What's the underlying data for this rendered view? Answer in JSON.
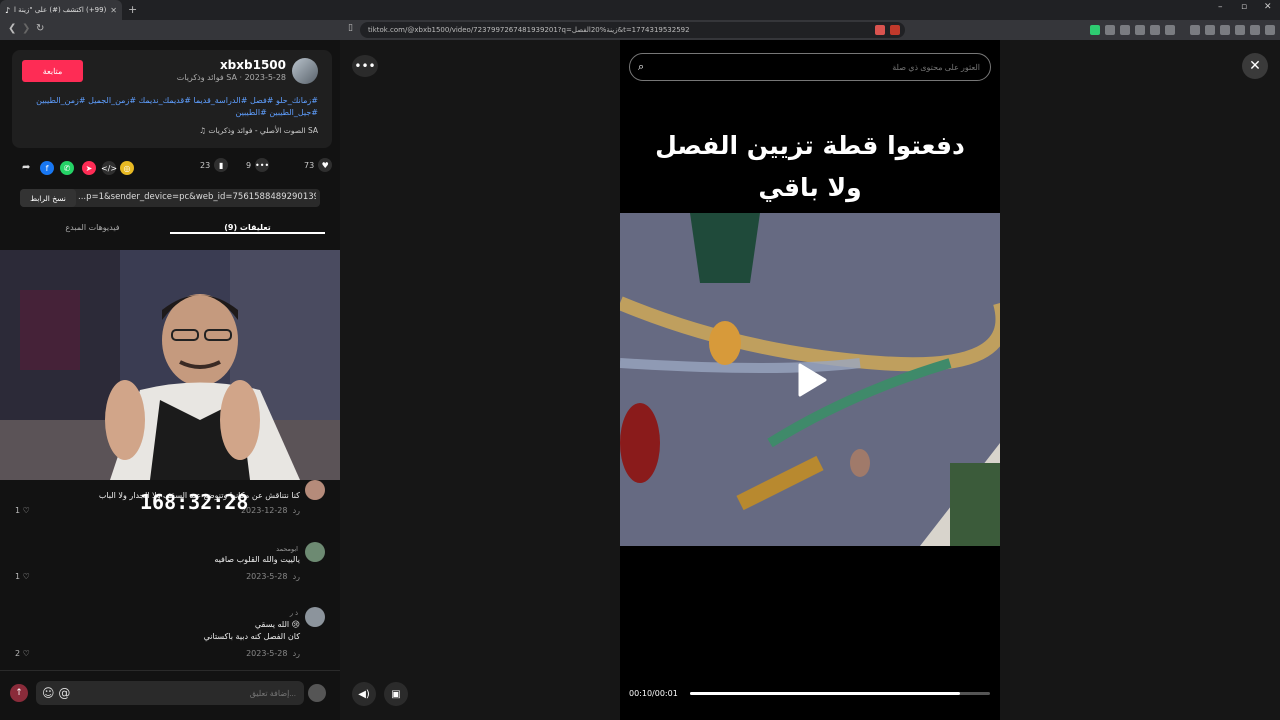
{
  "browser": {
    "tab_title": "(99+) اكتشف (#) على \"زينة الفصل\" على TikTok",
    "new_tab": "+",
    "url": "tiktok.com/@xbxb1500/video/7237997267481939201?q=زينة%20الفصل&t=1774319532592",
    "win_min": "–",
    "win_max": "▫",
    "win_close": "✕"
  },
  "post": {
    "username": "xbxb1500",
    "subline": "فوائد وذكريات SA · 2023-5-28",
    "follow_label": "متابعة",
    "hashtags": "#زمانك_حلو #فصل #الدراسة_قديما #قديمك_نديمك #زمن_الجميل #زمن_الطيبين #جيل_الطيبين #الطيبين",
    "sound": "♫  الصوت الأصلي - فوائد وذكريات SA",
    "likes": "73",
    "comments_count": "9",
    "saves": "23",
    "copy_label": "نسخ الرابط",
    "link": "...p=1&sender_device=pc&web_id=7561588489290139147"
  },
  "tabs": {
    "comments": "(9) تعليقات",
    "creator_videos": "فيديوهات المبدع"
  },
  "overlay": {
    "timer": "168:32:28"
  },
  "comments": [
    {
      "name": "",
      "text": "كنا نتناقش عن مكانها وتنوضع عند السقف ولا الجدار ولا الباب",
      "date": "2023-12-28",
      "reply": "رد",
      "likes": "1 ♡"
    },
    {
      "name": "ابومحمد",
      "text": "يالييت والله القلوب صافيه",
      "date": "2023-5-28",
      "reply": "رد",
      "likes": "1 ♡"
    },
    {
      "name": "ذ ر",
      "text": "الله يسقي 😢",
      "text2": "كان الفصل كنه دبية باكستاني",
      "date": "2023-5-28",
      "reply": "رد",
      "likes": "2 ♡"
    }
  ],
  "comment_input": {
    "placeholder": "إضافة تعليق..."
  },
  "video": {
    "search_placeholder": "العثور على محتوى ذي صلة",
    "caption_line1": "دفعتوا قطة تزيين الفصل",
    "caption_line2": "ولا باقي",
    "time": "00:10/00:01",
    "progress": 0.9
  },
  "colors": {
    "accent": "#fe2c55",
    "hashtag": "#5f9fff"
  }
}
